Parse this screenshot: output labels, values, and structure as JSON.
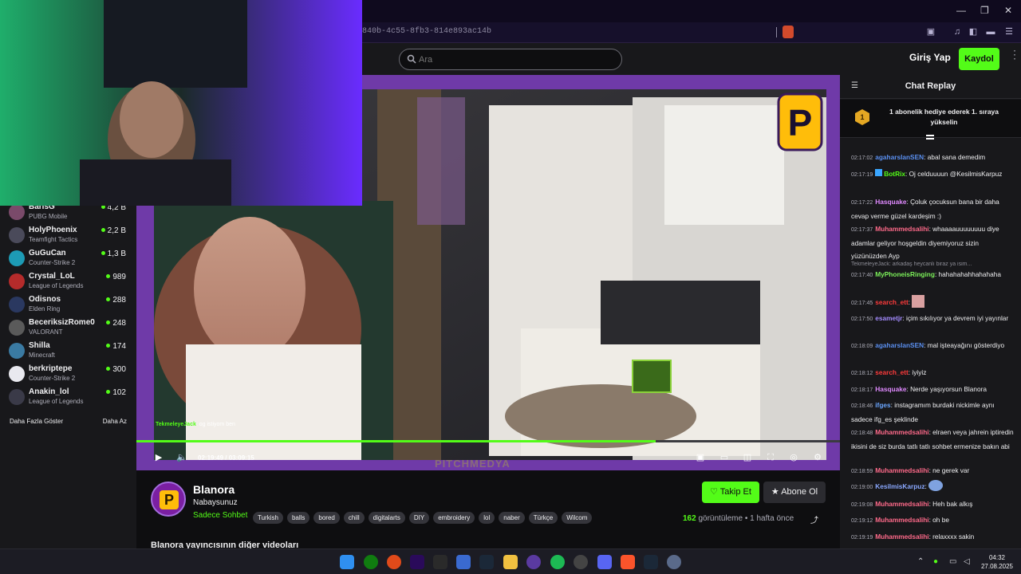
{
  "browser": {
    "url_fragment": "840b-4c55-8fb3-814e893ac14b"
  },
  "header": {
    "search_placeholder": "Ara",
    "login_label": "Giriş Yap",
    "signup_label": "Kaydol"
  },
  "sidebar": {
    "streams": [
      {
        "name": "BarisG",
        "game": "PUBG Mobile",
        "viewers": "4,2 B",
        "avatar_color": "#7a4a6a"
      },
      {
        "name": "HolyPhoenix",
        "game": "Teamfight Tactics",
        "viewers": "2,2 B",
        "avatar_color": "#4a4a5a"
      },
      {
        "name": "GuGuCan",
        "game": "Counter-Strike 2",
        "viewers": "1,3 B",
        "avatar_color": "#1d9bb5"
      },
      {
        "name": "Crystal_LoL",
        "game": "League of Legends",
        "viewers": "989",
        "avatar_color": "#b52b2b"
      },
      {
        "name": "Odisnos",
        "game": "Elden Ring",
        "viewers": "288",
        "avatar_color": "#2a3860"
      },
      {
        "name": "BeceriksizRome0",
        "game": "VALORANT",
        "viewers": "248",
        "avatar_color": "#5a5a5a"
      },
      {
        "name": "Shilla",
        "game": "Minecraft",
        "viewers": "174",
        "avatar_color": "#3a7aa2"
      },
      {
        "name": "berkriptepe",
        "game": "Counter-Strike 2",
        "viewers": "300",
        "avatar_color": "#e9e9ef"
      },
      {
        "name": "Anakin_lol",
        "game": "League of Legends",
        "viewers": "102",
        "avatar_color": "#3a3a48"
      }
    ],
    "show_more": "Daha Fazla Göster",
    "show_less": "Daha Az"
  },
  "player": {
    "time": "02:19:49 / 03:09:15",
    "progress": 0.738,
    "watermark": "PITCHMEDYA",
    "caption_user": "TekmeleyeJack",
    "caption_text": ": og istiyom ben",
    "overlay_logo": "P"
  },
  "channel": {
    "name": "Blanora",
    "subtitle": "Nabaysunuz",
    "category": "Sadece Sohbet",
    "tags": [
      "Turkish",
      "balls",
      "bored",
      "chill",
      "digitalarts",
      "DIY",
      "embroidery",
      "lol",
      "naber",
      "Türkçe",
      "Wilcom"
    ],
    "follow_label": "Takip Et",
    "subscribe_label": "Abone Ol",
    "views": "162",
    "views_label": "görüntüleme",
    "ago": "1 hafta önce",
    "other_videos": "Blanora yayıncısının diğer videoları"
  },
  "chat": {
    "title": "Chat Replay",
    "pinned_badge": "1",
    "pinned_text": "1 abonelik hediye ederek 1. sıraya yükselin",
    "messages": [
      {
        "time": "02:17:02",
        "user": "agaharslanSEN",
        "color": "#5a8ff0",
        "text": ": abal sana demedim"
      },
      {
        "time": "02:17:19",
        "user": "BotRix",
        "color": "#53fc18",
        "text": ": Oj celduuuun @KesilmisKarpuz"
      },
      {
        "time": "02:17:22",
        "user": "Hasquake",
        "color": "#e08aff",
        "text": ": Çoluk çocuksun bana bir daha cevap verme güzel kardeşim :)"
      },
      {
        "time": "02:17:37",
        "user": "Muhammedsalihi",
        "color": "#ff6a8a",
        "text": ": whaaaauuuuuuuu diye adamlar geliyor hoşgeldin diyemiyoruz sizin yüzünüzden Ayp"
      },
      {
        "time": "02:17:40",
        "user": "MyPhoneisRinging",
        "color": "#7cf05a",
        "text": ": hahahahahhahahaha",
        "reply": "TekmeleyeJack: arkadaş heycanlı biraz ya isim..."
      },
      {
        "time": "02:17:45",
        "user": "search_ett",
        "color": "#ff3b3b",
        "text": ":"
      },
      {
        "time": "02:17:50",
        "user": "esametjr",
        "color": "#a48bff",
        "text": ": içim sıkılıyor ya devrem iyi yayınlar"
      },
      {
        "time": "02:18:09",
        "user": "agaharslanSEN",
        "color": "#5a8ff0",
        "text": ": mal işteayağını gösterdiyo"
      },
      {
        "time": "02:18:12",
        "user": "search_ett",
        "color": "#ff3b3b",
        "text": ": iyiyiz"
      },
      {
        "time": "02:18:17",
        "user": "Hasquake",
        "color": "#e08aff",
        "text": ": Nerde yaşıyorsun Blanora"
      },
      {
        "time": "02:18:46",
        "user": "ifges",
        "color": "#6aa6ff",
        "text": ": instagramım burdaki nickimle aynı sadece ifg_es şeklinde"
      },
      {
        "time": "02:18:48",
        "user": "Muhammedsalihi",
        "color": "#ff6a8a",
        "text": ": elraen veya jahrein iptiredin ikisini de siz burda tatlı tatlı sohbet ermenize bakın abi"
      },
      {
        "time": "02:18:59",
        "user": "Muhammedsalihi",
        "color": "#ff6a8a",
        "text": ": ne gerek var"
      },
      {
        "time": "02:19:00",
        "user": "KesilmisKarpuz",
        "color": "#8aa8ff",
        "text": ":"
      },
      {
        "time": "02:19:08",
        "user": "Muhammedsalihi",
        "color": "#ff6a8a",
        "text": ": Heh bak alkış"
      },
      {
        "time": "02:19:12",
        "user": "Muhammedsalihi",
        "color": "#ff6a8a",
        "text": ": oh be"
      },
      {
        "time": "02:19:19",
        "user": "Muhammedsalihi",
        "color": "#ff6a8a",
        "text": ": relaxxxx sakin"
      }
    ]
  },
  "taskbar": {
    "time": "04:32",
    "date": "27.08.2025"
  },
  "colors": {
    "accent": "#53fc18",
    "player_border": "#6f3aa8",
    "bg": "#0e0e10"
  }
}
